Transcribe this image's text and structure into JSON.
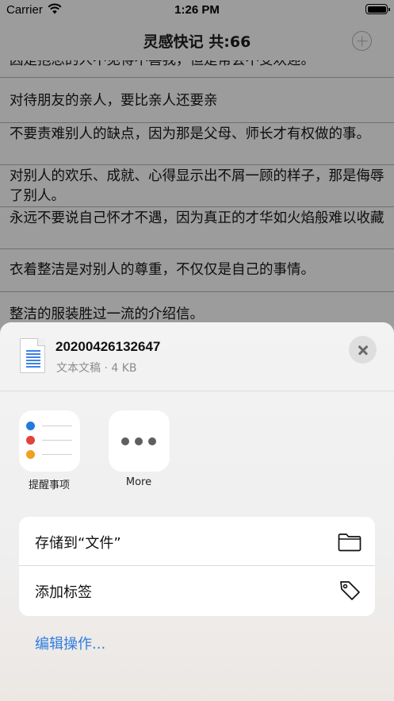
{
  "status": {
    "carrier": "Carrier",
    "time": "1:26 PM"
  },
  "nav": {
    "title": "灵感快记   共:66"
  },
  "list": {
    "items": [
      "因是抱怨的人不见得不喜我，但是常会不受欢迎。",
      "对待朋友的亲人，要比亲人还要亲",
      "不要责难别人的缺点，因为那是父母、师长才有权做的事。",
      "对别人的欢乐、成就、心得显示出不屑一顾的样子，那是侮辱了别人。",
      "永远不要说自己怀才不遇，因为真正的才华如火焰般难以收藏",
      "衣着整洁是对别人的尊重，不仅仅是自己的事情。",
      "整洁的服装胜过一流的介绍信。"
    ]
  },
  "sheet": {
    "file_name": "20200426132647",
    "file_meta": "文本文稿 · 4 KB",
    "apps": [
      {
        "label": "提醒事项",
        "icon": "reminders-icon"
      },
      {
        "label": "More",
        "icon": "more-icon"
      }
    ],
    "actions": [
      {
        "label": "存储到“文件”",
        "icon": "folder-icon"
      },
      {
        "label": "添加标签",
        "icon": "tag-icon"
      }
    ],
    "edit_actions": "编辑操作..."
  },
  "colors": {
    "accent": "#2f7de1",
    "reminder_dots": [
      "#1f7bdc",
      "#e2443a",
      "#f0a020"
    ],
    "dim_background": "#9c9c9c"
  }
}
